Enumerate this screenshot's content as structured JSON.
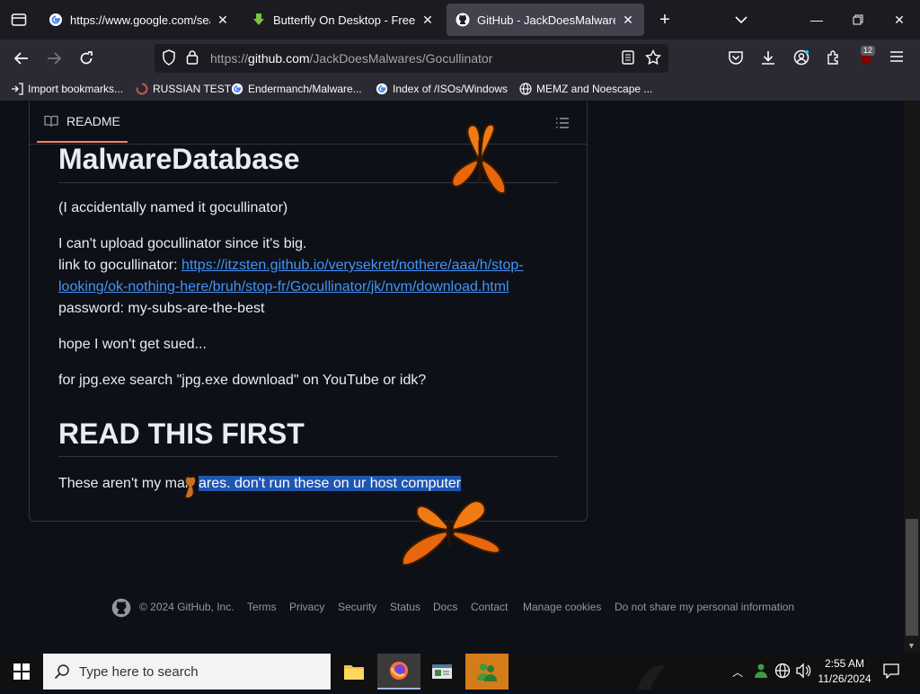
{
  "browser": {
    "tabs": [
      {
        "title": "https://www.google.com/search",
        "icon": "google-icon"
      },
      {
        "title": "Butterfly On Desktop - Freeware",
        "icon": "download-arrow-icon"
      },
      {
        "title": "GitHub - JackDoesMalwares/Gocullinator",
        "icon": "github-icon",
        "active": true
      }
    ],
    "url": {
      "prefix": "https://",
      "host": "github.com",
      "path": "/JackDoesMalwares/Gocullinator"
    },
    "extensions_badge": "12",
    "bookmarks": [
      {
        "label": "Import bookmarks...",
        "icon": "import-icon"
      },
      {
        "label": "RUSSIAN TEST",
        "icon": "spinner-icon"
      },
      {
        "label": "Endermanch/Malware...",
        "icon": "google-icon"
      },
      {
        "label": "Index of /ISOs/Windows",
        "icon": "google-icon"
      },
      {
        "label": "MEMZ and Noescape ...",
        "icon": "globe-icon"
      }
    ]
  },
  "readme": {
    "tab_label": "README",
    "heading1": "MalwareDatabase",
    "p1": "(I accidentally named it gocullinator)",
    "p2_line1": "I can't upload gocullinator since it's big.",
    "p2_line2_prefix": "link to gocullinator: ",
    "link_line1": "https://itzsten.github.io/verysekret/nothere/aaa/h/stop-",
    "link_line2": "looking/ok-nothing-here/bruh/stop-fr/Gocullinator/jk/nvm/download.html",
    "p2_line3": "password: my-subs-are-the-best",
    "p3": "hope I won't get sued...",
    "p4": "for jpg.exe search \"jpg.exe download\" on YouTube or idk?",
    "heading2": "READ THIS FIRST",
    "p5_plain": "These aren't my mal",
    "p5_hidden": "w",
    "p5_selected": "ares. don't run these on ur host computer"
  },
  "footer": {
    "copyright": "© 2024 GitHub, Inc.",
    "links": [
      "Terms",
      "Privacy",
      "Security",
      "Status",
      "Docs",
      "Contact",
      "Manage cookies",
      "Do not share my personal information"
    ]
  },
  "taskbar": {
    "search_placeholder": "Type here to search",
    "time": "2:55 AM",
    "date": "11/26/2024"
  },
  "colors": {
    "page_bg": "#0d1117",
    "link": "#4493f8",
    "selection": "#1f56b0",
    "butterfly": "#f07a14"
  }
}
